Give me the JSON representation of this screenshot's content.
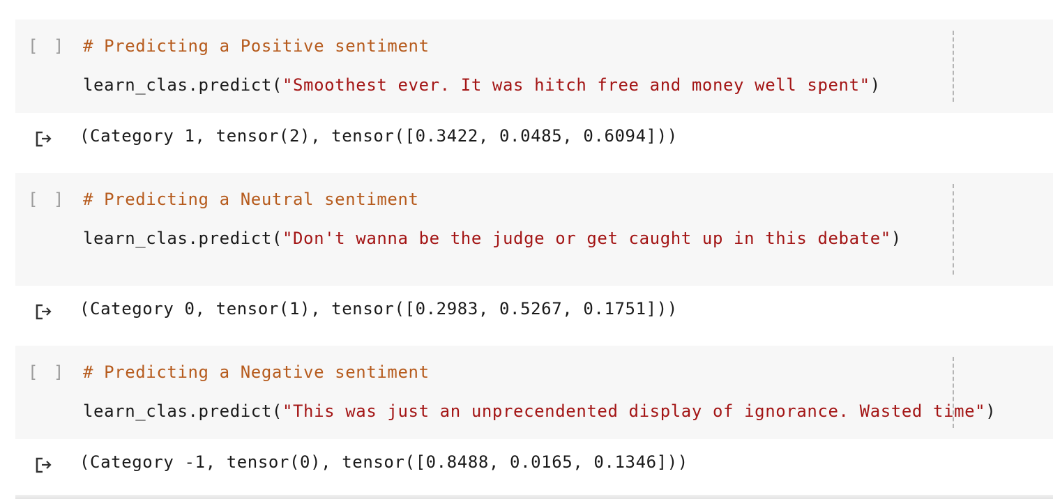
{
  "cells": [
    {
      "run_label": "[ ]",
      "comment": "# Predicting a Positive sentiment",
      "code_prefix": "learn_clas.predict(",
      "code_string": "\"Smoothest ever. It was hitch free and money well spent\"",
      "code_suffix": ")",
      "output": "(Category 1, tensor(2), tensor([0.3422, 0.0485, 0.6094]))"
    },
    {
      "run_label": "[ ]",
      "comment": "# Predicting a Neutral sentiment",
      "code_prefix": "learn_clas.predict(",
      "code_string": "\"Don't wanna be the judge or get caught up in this debate\"",
      "code_suffix": ")",
      "output": "(Category 0, tensor(1), tensor([0.2983, 0.5267, 0.1751]))"
    },
    {
      "run_label": "[ ]",
      "comment": "# Predicting a Negative sentiment",
      "code_prefix": "learn_clas.predict(",
      "code_string": "\"This was just an unprecendented display of ignorance. Wasted time\"",
      "code_suffix": ")",
      "output": "(Category -1, tensor(0), tensor([0.8488, 0.0165, 0.1346]))"
    }
  ],
  "icons": {
    "output": "output-arrow-icon"
  },
  "colors": {
    "comment": "#b65b1d",
    "string": "#a31515",
    "cell_bg": "#f7f7f7"
  }
}
